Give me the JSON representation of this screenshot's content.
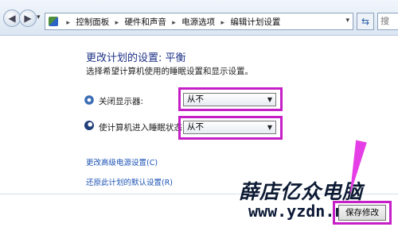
{
  "address_bar": {
    "crumbs": [
      "控制面板",
      "硬件和声音",
      "电源选项",
      "编辑计划设置"
    ],
    "separator": "▸",
    "search_placeholder": "搜"
  },
  "page": {
    "title": "更改计划的设置: 平衡",
    "subtitle": "选择希望计算机使用的睡眠设置和显示设置。"
  },
  "settings": [
    {
      "label": "关闭显示器:",
      "value": "从不",
      "icon": "monitor-icon"
    },
    {
      "label": "使计算机进入睡眠状态:",
      "value": "从不",
      "icon": "sleep-icon"
    }
  ],
  "links": {
    "advanced": "更改高级电源设置(C)",
    "restore": "还原此计划的默认设置(R)"
  },
  "buttons": {
    "save": "保存修改"
  },
  "watermark": {
    "text": "薛店亿众电脑",
    "url": "www.yzdn.net"
  },
  "colors": {
    "highlight": "#c71fc7",
    "link": "#1b52b5",
    "title": "#1e3287"
  }
}
